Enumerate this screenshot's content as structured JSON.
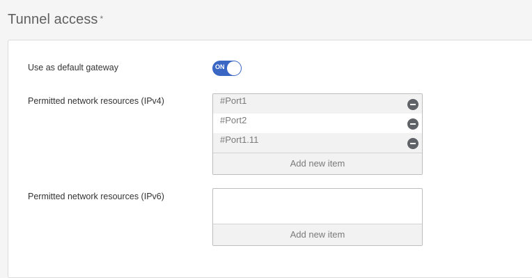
{
  "section": {
    "title": "Tunnel access",
    "required_mark": "*"
  },
  "gateway": {
    "label": "Use as default gateway",
    "toggle_text": "ON",
    "enabled": true
  },
  "ipv4": {
    "label": "Permitted network resources (IPv4)",
    "items": [
      {
        "label": "#Port1"
      },
      {
        "label": "#Port2"
      },
      {
        "label": "#Port1.11"
      }
    ],
    "add_label": "Add new item"
  },
  "ipv6": {
    "label": "Permitted network resources (IPv6)",
    "items": [],
    "add_label": "Add new item"
  },
  "colors": {
    "toggle_on": "#3a66c4",
    "remove_icon": "#5f6368"
  },
  "icons": {
    "remove": "minus-circle-icon"
  }
}
